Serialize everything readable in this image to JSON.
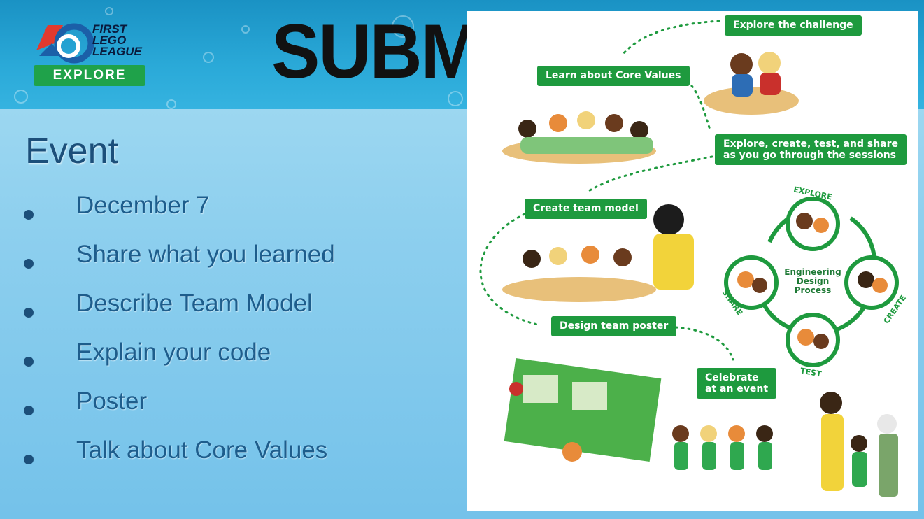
{
  "banner": {
    "logo_line1": "FIRST",
    "logo_line2": "LEGO",
    "logo_line3": "LEAGUE",
    "logo_badge": "EXPLORE",
    "title": "SUBME"
  },
  "content": {
    "heading": "Event",
    "bullets": [
      "December 7",
      "Share what you learned",
      "Describe Team Model",
      "Explain your code",
      "Poster",
      "Talk about Core Values"
    ]
  },
  "poster": {
    "steps": [
      "Explore the challenge",
      "Learn about Core Values",
      "Explore, create, test, and share",
      "as you go through the sessions",
      "Create team model",
      "Design team poster",
      "Celebrate",
      "at an event"
    ],
    "cycle": {
      "center_line1": "Engineering",
      "center_line2": "Design",
      "center_line3": "Process",
      "explore": "EXPLORE",
      "create": "CREATE",
      "test": "TEST",
      "share": "SHARE"
    }
  },
  "colors": {
    "banner": "#2aa9d8",
    "background": "#8dcfee",
    "heading": "#1c4f7a",
    "bullet_text": "#1e5d8c",
    "green": "#1e9a3e"
  }
}
